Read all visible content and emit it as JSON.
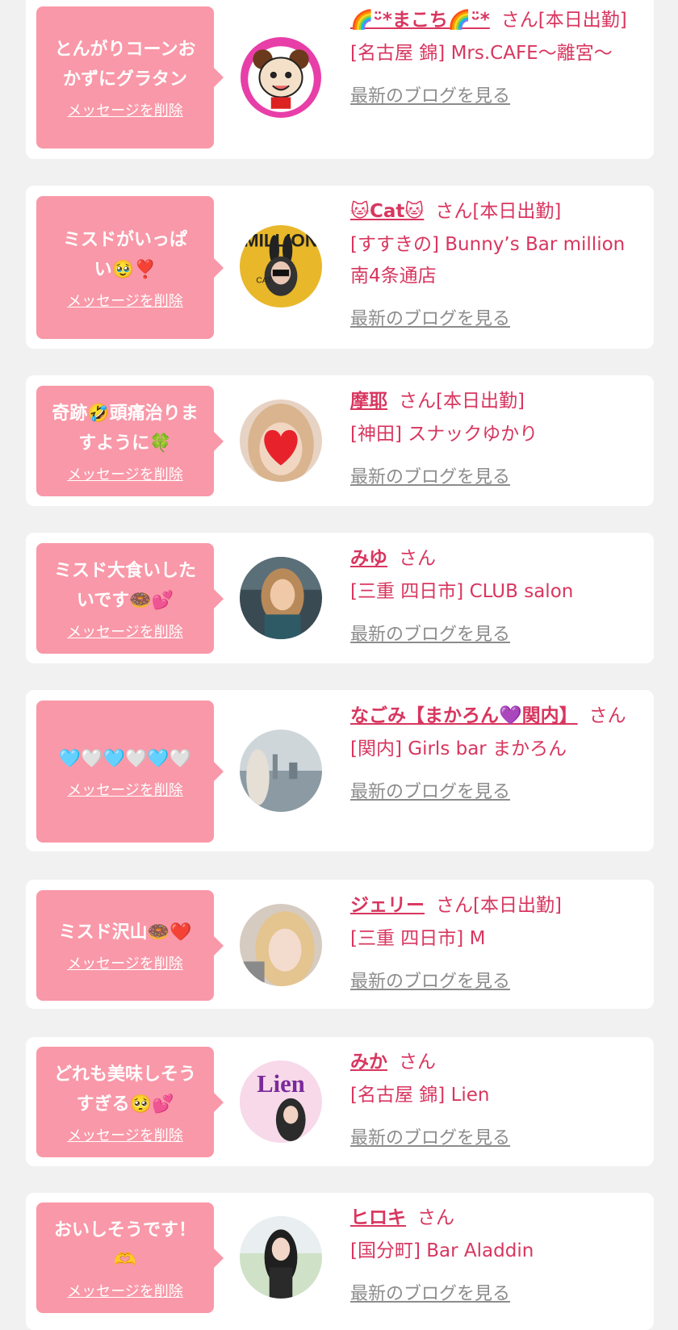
{
  "colors": {
    "accent": "#d8365f",
    "bubble": "#f998a8",
    "background": "#f1f1f1",
    "link_gray": "#8c8c8c"
  },
  "delete_label": "メッセージを削除",
  "blog_label": "最新のブログを見る",
  "items": [
    {
      "message": "とんがりコーンおかずにグラタン",
      "name": "🌈ᵕ̈*まこち🌈ᵕ̈*",
      "suffix": "さん[本日出勤]",
      "shop": "[名古屋 錦] Mrs.CAFE〜離宮〜",
      "avatar": "cartoon-girl-avatar"
    },
    {
      "message": "ミスドがいっぱい🥹❣️",
      "name": "🐱Cat🐱",
      "suffix": "さん[本日出勤]",
      "shop": "[すすきの] Bunny’s Bar million 南4条通店",
      "avatar": "bunny-magazine-avatar"
    },
    {
      "message": "奇跡🤣頭痛治りますように🍀",
      "name": "摩耶",
      "suffix": "さん[本日出勤]",
      "shop": "[神田] スナックゆかり",
      "avatar": "heart-face-avatar"
    },
    {
      "message": "ミスド大食いしたいです🍩💕",
      "name": "みゆ",
      "suffix": "さん",
      "shop": "[三重 四日市] CLUB salon",
      "avatar": "woman-photo-avatar"
    },
    {
      "message": "🩵🤍🩵🤍🩵🤍",
      "name": "なごみ【まかろん💜関内】",
      "suffix": "さん",
      "shop": "[関内] Girls bar まかろん",
      "avatar": "city-view-avatar"
    },
    {
      "message": "ミスド沢山🍩❤️",
      "name": "ジェリー",
      "suffix": "さん[本日出勤]",
      "shop": "[三重 四日市] M",
      "avatar": "blonde-woman-avatar"
    },
    {
      "message": "どれも美味しそうすぎる🥺💕",
      "name": "みか",
      "suffix": "さん",
      "shop": "[名古屋 錦] Lien",
      "avatar": "lien-logo-avatar"
    },
    {
      "message": "おいしそうです！🫶",
      "name": "ヒロキ",
      "suffix": "さん",
      "shop": "[国分町] Bar Aladdin",
      "avatar": "woman-outdoor-avatar"
    }
  ]
}
